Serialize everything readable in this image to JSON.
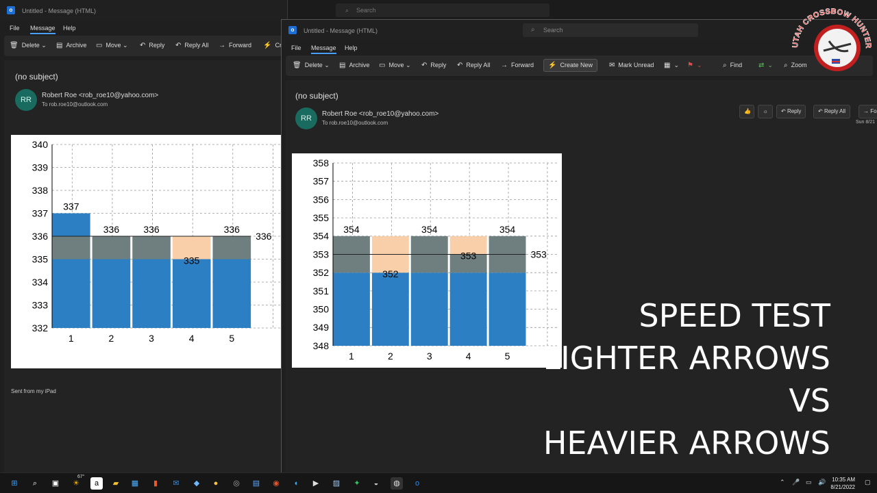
{
  "left_window": {
    "title": "Untitled - Message (HTML)",
    "search_placeholder": "Search",
    "menu": [
      "File",
      "Message",
      "Help"
    ],
    "ribbon": [
      "Delete",
      "Archive",
      "Move",
      "Reply",
      "Reply All",
      "Forward",
      "Cr"
    ],
    "subject": "(no subject)",
    "avatar": "RR",
    "sender": "Robert Roe <rob_roe10@yahoo.com>",
    "to": "To  rob.roe10@outlook.com",
    "signature": "Sent from my iPad"
  },
  "right_window": {
    "title": "Untitled - Message (HTML)",
    "search_placeholder": "Search",
    "menu": [
      "File",
      "Message",
      "Help"
    ],
    "ribbon": [
      "Delete",
      "Archive",
      "Move",
      "Reply",
      "Reply All",
      "Forward",
      "Create New",
      "Mark Unread",
      "Find",
      "Zoom"
    ],
    "subject": "(no subject)",
    "avatar": "RR",
    "sender": "Robert Roe <rob_roe10@yahoo.com>",
    "to": "To  rob.roe10@outlook.com",
    "actions": [
      "Reply",
      "Reply All",
      "Fo"
    ],
    "date": "Sun 8/21"
  },
  "chart_data": [
    {
      "type": "bar",
      "categories": [
        "1",
        "2",
        "3",
        "4",
        "5"
      ],
      "values": [
        337,
        336,
        336,
        335,
        336
      ],
      "ylim": [
        332,
        340
      ],
      "yticks": [
        332,
        333,
        334,
        335,
        336,
        337,
        338,
        339,
        340
      ],
      "average": 336,
      "band": [
        335,
        336
      ],
      "grid": true,
      "colors": {
        "bar": "#2b7fc2",
        "band": "#6f7f80",
        "below": "#f8cfa8"
      }
    },
    {
      "type": "bar",
      "categories": [
        "1",
        "2",
        "3",
        "4",
        "5"
      ],
      "values": [
        354,
        352,
        354,
        353,
        354
      ],
      "ylim": [
        348,
        358
      ],
      "yticks": [
        348,
        349,
        350,
        351,
        352,
        353,
        354,
        355,
        356,
        357,
        358
      ],
      "average": 353,
      "band": [
        352,
        354
      ],
      "grid": true,
      "colors": {
        "bar": "#2b7fc2",
        "band": "#6f7f80",
        "below": "#f8cfa8"
      }
    }
  ],
  "overlay": [
    "SPEED TEST",
    "LIGHTER ARROWS",
    "VS",
    "HEAVIER ARROWS"
  ],
  "logo_text": "UTAH CROSSBOW HUNTER",
  "taskbar": {
    "weather": "67°",
    "time": "10:35 AM",
    "date": "8/21/2022"
  }
}
